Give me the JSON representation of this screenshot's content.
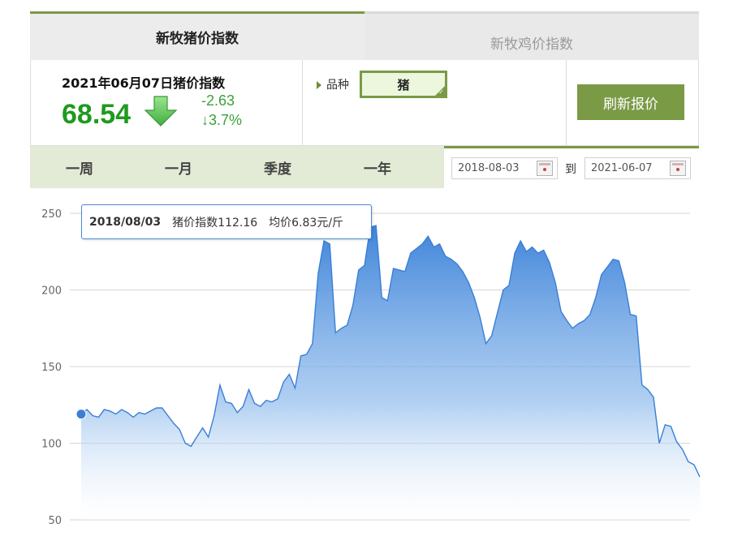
{
  "tabs": {
    "active_label": "新牧猪价指数",
    "inactive_label": "新牧鸡价指数"
  },
  "summary": {
    "title": "2021年06月07日猪价指数",
    "value": "68.54",
    "change": "-2.63",
    "change_pct": "↓3.7%",
    "direction": "down"
  },
  "variety": {
    "label": "品种",
    "selected": "猪"
  },
  "refresh_button": "刷新报价",
  "periods": [
    "一周",
    "一月",
    "季度",
    "一年"
  ],
  "date_range": {
    "start": "2018-08-03",
    "to_label": "到",
    "end": "2021-06-07"
  },
  "tooltip": {
    "date": "2018/08/03",
    "index_text": "猪价指数112.16",
    "price_text": "均价6.83元/斤"
  },
  "colors": {
    "accent_green": "#7a9a46",
    "index_green": "#1f9a1f",
    "line_blue": "#3a7fd5",
    "fill_top": "#4a8ad8"
  },
  "chart_data": {
    "type": "area",
    "title": "",
    "xlabel": "",
    "ylabel": "",
    "x_start": "2018-08-03",
    "x_end": "2021-06-07",
    "ylim": [
      50,
      250
    ],
    "yticks": [
      50,
      100,
      150,
      200,
      250
    ],
    "grid": true,
    "highlight": {
      "x": "2018-08-03",
      "y": 112.16
    },
    "series": [
      {
        "values": [
          119,
          122,
          118,
          117,
          122,
          121,
          119,
          122,
          120,
          117,
          120,
          119,
          121,
          123,
          123,
          118,
          113,
          109,
          100,
          98,
          104,
          110,
          104,
          118,
          138,
          127,
          126,
          120,
          124,
          135,
          126,
          124,
          128,
          127,
          129,
          140,
          145,
          136,
          157,
          158,
          165,
          211,
          232,
          230,
          172,
          175,
          177,
          190,
          213,
          216,
          241,
          242,
          195,
          193,
          214,
          213,
          212,
          224,
          227,
          230,
          235,
          228,
          230,
          222,
          220,
          217,
          212,
          205,
          195,
          182,
          165,
          170,
          185,
          200,
          203,
          224,
          232,
          225,
          228,
          224,
          226,
          218,
          205,
          186,
          180,
          175,
          178,
          180,
          184,
          195,
          210,
          215,
          220,
          219,
          205,
          184,
          183,
          138,
          135,
          130,
          100,
          112,
          111,
          101,
          96,
          88,
          86,
          78
        ]
      }
    ]
  }
}
